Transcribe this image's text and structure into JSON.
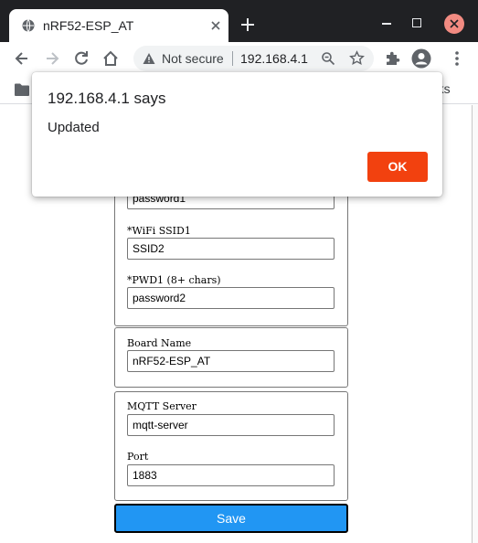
{
  "browser": {
    "tab_title": "nRF52-ESP_AT",
    "security_label": "Not secure",
    "url": "192.168.4.1",
    "bookmarks_partial": "rks"
  },
  "form": {
    "wifi_group": {
      "pwd0_value": "password1",
      "ssid1_label": "*WiFi SSID1",
      "ssid1_value": "SSID2",
      "pwd1_label": "*PWD1 (8+ chars)",
      "pwd1_value": "password2"
    },
    "board_group": {
      "board_name_label": "Board Name",
      "board_name_value": "nRF52-ESP_AT"
    },
    "mqtt_group": {
      "server_label": "MQTT Server",
      "server_value": "mqtt-server",
      "port_label": "Port",
      "port_value": "1883"
    },
    "save_label": "Save"
  },
  "dialog": {
    "title": "192.168.4.1 says",
    "message": "Updated",
    "ok_label": "OK"
  },
  "colors": {
    "chrome_dark": "#202124",
    "save_button": "#2196f3",
    "ok_button": "#f2410f",
    "window_close": "#f28b82"
  },
  "icons": [
    "globe-icon",
    "tab-close-icon",
    "new-tab-icon",
    "back-icon",
    "forward-icon",
    "reload-icon",
    "home-icon",
    "warning-icon",
    "zoom-icon",
    "star-icon",
    "extensions-icon",
    "profile-icon",
    "menu-icon",
    "folder-icon"
  ]
}
